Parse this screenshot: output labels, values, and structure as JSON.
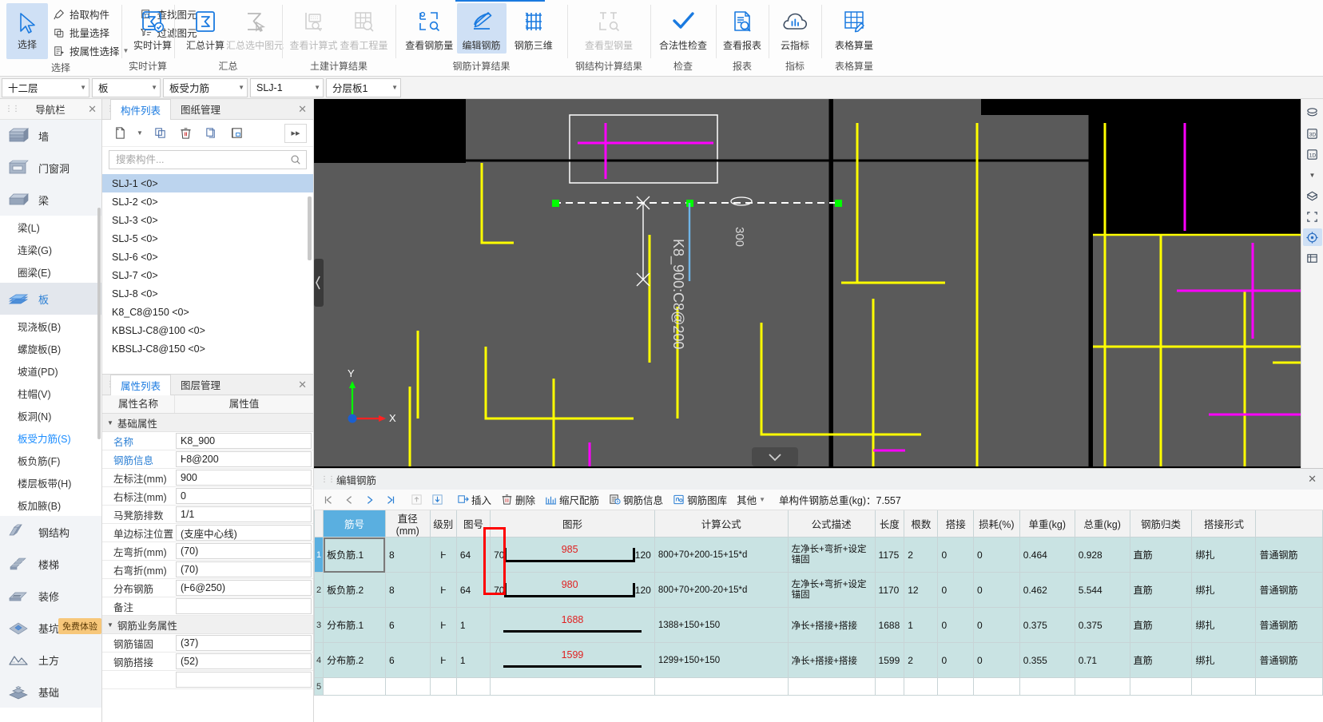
{
  "ribbon": {
    "groups": [
      {
        "label": "选择",
        "select_button": "选择",
        "small_items": [
          {
            "label": "拾取构件",
            "icon": "pick-component-icon",
            "caret": false
          },
          {
            "label": "批量选择",
            "icon": "batch-select-icon",
            "caret": false
          },
          {
            "label": "按属性选择",
            "icon": "select-by-property-icon",
            "caret": true
          }
        ],
        "small_items2": [
          {
            "label": "查找图元",
            "icon": "find-element-icon",
            "caret": false
          },
          {
            "label": "过滤图元",
            "icon": "filter-element-icon",
            "caret": false
          }
        ]
      },
      {
        "label": "实时计算",
        "buttons": [
          {
            "label": "实时计算",
            "icon": "realtime-calc-icon",
            "disabled": false,
            "selected": false
          }
        ]
      },
      {
        "label": "汇总",
        "buttons": [
          {
            "label": "汇总计算",
            "icon": "summary-calc-icon",
            "disabled": false,
            "selected": false
          },
          {
            "label": "汇总选中图元",
            "icon": "summary-selected-icon",
            "disabled": true,
            "selected": false
          }
        ]
      },
      {
        "label": "土建计算结果",
        "buttons": [
          {
            "label": "查看计算式",
            "icon": "view-formula-icon",
            "disabled": true,
            "selected": false
          },
          {
            "label": "查看工程量",
            "icon": "view-quantity-icon",
            "disabled": true,
            "selected": false
          }
        ]
      },
      {
        "label": "钢筋计算结果",
        "buttons": [
          {
            "label": "查看钢筋量",
            "icon": "view-rebar-quantity-icon",
            "disabled": false,
            "selected": false
          },
          {
            "label": "编辑钢筋",
            "icon": "edit-rebar-icon",
            "disabled": false,
            "selected": true
          },
          {
            "label": "钢筋三维",
            "icon": "rebar-3d-icon",
            "disabled": false,
            "selected": false
          }
        ]
      },
      {
        "label": "钢结构计算结果",
        "buttons": [
          {
            "label": "查看型钢量",
            "icon": "view-steel-quantity-icon",
            "disabled": true,
            "selected": false
          }
        ]
      },
      {
        "label": "检查",
        "buttons": [
          {
            "label": "合法性检查",
            "icon": "check-mark-icon",
            "disabled": false,
            "selected": false
          }
        ]
      },
      {
        "label": "报表",
        "buttons": [
          {
            "label": "查看报表",
            "icon": "view-report-icon",
            "disabled": false,
            "selected": false
          }
        ]
      },
      {
        "label": "指标",
        "buttons": [
          {
            "label": "云指标",
            "icon": "cloud-indicator-icon",
            "disabled": false,
            "selected": false
          }
        ]
      },
      {
        "label": "表格算量",
        "buttons": [
          {
            "label": "表格算量",
            "icon": "table-quantity-icon",
            "disabled": false,
            "selected": false
          }
        ]
      }
    ]
  },
  "selector_bar": {
    "combos": [
      {
        "name": "floor-select",
        "value": "十二层"
      },
      {
        "name": "category-select",
        "value": "板"
      },
      {
        "name": "element-type-select",
        "value": "板受力筋"
      },
      {
        "name": "component-select",
        "value": "SLJ-1"
      },
      {
        "name": "layer-select",
        "value": "分层板1"
      }
    ]
  },
  "nav": {
    "title": "导航栏",
    "close": "✕",
    "items": [
      {
        "label": "墙",
        "type": "cat",
        "icon": "wall-icon",
        "active": false
      },
      {
        "label": "门窗洞",
        "type": "cat",
        "icon": "door-window-icon",
        "active": false
      },
      {
        "label": "梁",
        "type": "cat",
        "icon": "beam-icon",
        "active": false
      },
      {
        "label": "梁(L)",
        "type": "sub",
        "active": false
      },
      {
        "label": "连梁(G)",
        "type": "sub",
        "active": false
      },
      {
        "label": "圈梁(E)",
        "type": "sub",
        "active": false
      },
      {
        "label": "板",
        "type": "cat",
        "icon": "slab-icon",
        "active": true
      },
      {
        "label": "现浇板(B)",
        "type": "sub",
        "active": false
      },
      {
        "label": "螺旋板(B)",
        "type": "sub",
        "active": false
      },
      {
        "label": "坡道(PD)",
        "type": "sub",
        "active": false
      },
      {
        "label": "柱帽(V)",
        "type": "sub",
        "active": false
      },
      {
        "label": "板洞(N)",
        "type": "sub",
        "active": false
      },
      {
        "label": "板受力筋(S)",
        "type": "sub",
        "active": true
      },
      {
        "label": "板负筋(F)",
        "type": "sub",
        "active": false
      },
      {
        "label": "楼层板带(H)",
        "type": "sub",
        "active": false
      },
      {
        "label": "板加腋(B)",
        "type": "sub",
        "active": false
      },
      {
        "label": "钢结构",
        "type": "cat",
        "icon": "steel-structure-icon",
        "active": false
      },
      {
        "label": "楼梯",
        "type": "cat",
        "icon": "stairs-icon",
        "active": false
      },
      {
        "label": "装修",
        "type": "cat",
        "icon": "decoration-icon",
        "active": false
      },
      {
        "label": "基坑工程",
        "type": "cat",
        "icon": "foundation-pit-icon",
        "active": false
      },
      {
        "label": "土方",
        "type": "cat",
        "icon": "earthwork-icon",
        "active": false
      },
      {
        "label": "基础",
        "type": "cat",
        "icon": "foundation-icon",
        "active": false
      }
    ],
    "free_trial_badge": "免费体验"
  },
  "component_panel": {
    "tabs": [
      {
        "label": "构件列表",
        "selected": true
      },
      {
        "label": "图纸管理",
        "selected": false
      }
    ],
    "close": "✕",
    "tools": [
      {
        "name": "new-component-button",
        "icon": "new-doc-icon"
      },
      {
        "name": "new-component-dropdown",
        "icon": "chevron-down-icon"
      },
      {
        "name": "copy-component-button",
        "icon": "copy-icon"
      },
      {
        "name": "delete-component-button",
        "icon": "trash-icon"
      },
      {
        "name": "duplicate-component-button",
        "icon": "layers-icon"
      },
      {
        "name": "save-component-button",
        "icon": "save-icon"
      },
      {
        "name": "expand-button",
        "icon": "double-chevron-right-icon"
      }
    ],
    "search_placeholder": "搜索构件...",
    "items": [
      {
        "label": "SLJ-1 <0>",
        "selected": true
      },
      {
        "label": "SLJ-2 <0>",
        "selected": false
      },
      {
        "label": "SLJ-3 <0>",
        "selected": false
      },
      {
        "label": "SLJ-5 <0>",
        "selected": false
      },
      {
        "label": "SLJ-6 <0>",
        "selected": false
      },
      {
        "label": "SLJ-7 <0>",
        "selected": false
      },
      {
        "label": "SLJ-8 <0>",
        "selected": false
      },
      {
        "label": "K8_C8@150 <0>",
        "selected": false
      },
      {
        "label": "KBSLJ-C8@100 <0>",
        "selected": false
      },
      {
        "label": "KBSLJ-C8@150 <0>",
        "selected": false
      }
    ]
  },
  "property_panel": {
    "tabs": [
      {
        "label": "属性列表",
        "selected": true
      },
      {
        "label": "图层管理",
        "selected": false
      }
    ],
    "close": "✕",
    "header": {
      "name_col": "属性名称",
      "value_col": "属性值"
    },
    "groups": [
      {
        "title": "基础属性",
        "rows": [
          {
            "name": "名称",
            "value": "K8_900",
            "blue": true
          },
          {
            "name": "钢筋信息",
            "value": "Ⱶ8@200",
            "blue": true
          },
          {
            "name": "左标注(mm)",
            "value": "900",
            "blue": false
          },
          {
            "name": "右标注(mm)",
            "value": "0",
            "blue": false
          },
          {
            "name": "马凳筋排数",
            "value": "1/1",
            "blue": false
          },
          {
            "name": "单边标注位置",
            "value": "(支座中心线)",
            "blue": false
          },
          {
            "name": "左弯折(mm)",
            "value": "(70)",
            "blue": false
          },
          {
            "name": "右弯折(mm)",
            "value": "(70)",
            "blue": false
          },
          {
            "name": "分布钢筋",
            "value": "(Ⱶ6@250)",
            "blue": false
          },
          {
            "name": "备注",
            "value": "",
            "blue": false
          }
        ]
      },
      {
        "title": "钢筋业务属性",
        "rows": [
          {
            "name": "钢筋锚固",
            "value": "(37)",
            "blue": false
          },
          {
            "name": "钢筋搭接",
            "value": "(52)",
            "blue": false
          }
        ]
      }
    ]
  },
  "canvas": {
    "annotations": [
      {
        "text": "K8_900:C8@200",
        "name": "rebar-label-k8-900"
      },
      {
        "text": "300",
        "name": "dimension-300"
      }
    ],
    "axis_x": "X",
    "axis_y": "Y"
  },
  "right_toolbar": {
    "buttons": [
      {
        "name": "view-layers-icon",
        "selected": false
      },
      {
        "name": "view-3d-icon",
        "selected": false
      },
      {
        "name": "view-dropdown-icon",
        "selected": false
      },
      {
        "name": "view-solid-icon",
        "selected": false
      },
      {
        "name": "view-fullscreen-icon",
        "selected": false
      },
      {
        "name": "view-target-icon",
        "selected": true
      },
      {
        "name": "view-table-icon",
        "selected": false
      }
    ],
    "labels": [
      "3D",
      "1D"
    ]
  },
  "bottom_panel": {
    "title": "编辑钢筋",
    "close": "✕",
    "nav_buttons": [
      {
        "name": "first-record-button",
        "icon": "first-icon"
      },
      {
        "name": "prev-record-button",
        "icon": "prev-icon"
      },
      {
        "name": "next-record-button",
        "icon": "next-icon"
      },
      {
        "name": "last-record-button",
        "icon": "last-icon"
      },
      {
        "name": "move-up-button",
        "icon": "up-arrow-icon"
      },
      {
        "name": "move-down-button",
        "icon": "down-arrow-icon"
      }
    ],
    "tools": [
      {
        "label": "插入",
        "icon": "insert-icon"
      },
      {
        "label": "删除",
        "icon": "delete-icon"
      },
      {
        "label": "缩尺配筋",
        "icon": "scale-rebar-icon"
      },
      {
        "label": "钢筋信息",
        "icon": "rebar-info-icon"
      },
      {
        "label": "钢筋图库",
        "icon": "rebar-library-icon"
      },
      {
        "label": "其他",
        "icon": "other-icon",
        "caret": true
      }
    ],
    "total_label": "单构件钢筋总重(kg)：7.557",
    "table": {
      "columns": [
        "筋号",
        "直径(mm)",
        "级别",
        "图号",
        "图形",
        "计算公式",
        "公式描述",
        "长度",
        "根数",
        "搭接",
        "损耗(%)",
        "单重(kg)",
        "总重(kg)",
        "钢筋归类",
        "搭接形式"
      ],
      "rows": [
        {
          "idx": "1",
          "筋号": "板负筋.1",
          "直径(mm)": "8",
          "级别": "Ⱶ",
          "图号": "64",
          "shape": {
            "left": "70",
            "mid": "985",
            "right": "120",
            "type": "hooked-both"
          },
          "计算公式": "800+70+200-15+15*d",
          "公式描述": "左净长+弯折+设定锚固",
          "长度": "1175",
          "根数": "2",
          "搭接": "0",
          "损耗(%)": "0",
          "单重(kg)": "0.464",
          "总重(kg)": "0.928",
          "钢筋归类": "直筋",
          "搭接形式": "绑扎",
          "普通钢筋": "普通钢筋",
          "selected": true
        },
        {
          "idx": "2",
          "筋号": "板负筋.2",
          "直径(mm)": "8",
          "级别": "Ⱶ",
          "图号": "64",
          "shape": {
            "left": "70",
            "mid": "980",
            "right": "120",
            "type": "hooked-both"
          },
          "计算公式": "800+70+200-20+15*d",
          "公式描述": "左净长+弯折+设定锚固",
          "长度": "1170",
          "根数": "12",
          "搭接": "0",
          "损耗(%)": "0",
          "单重(kg)": "0.462",
          "总重(kg)": "5.544",
          "钢筋归类": "直筋",
          "搭接形式": "绑扎",
          "普通钢筋": "普通钢筋",
          "selected": false
        },
        {
          "idx": "3",
          "筋号": "分布筋.1",
          "直径(mm)": "6",
          "级别": "Ⱶ",
          "图号": "1",
          "shape": {
            "left": "",
            "mid": "1688",
            "right": "",
            "type": "straight"
          },
          "计算公式": "1388+150+150",
          "公式描述": "净长+搭接+搭接",
          "长度": "1688",
          "根数": "1",
          "搭接": "0",
          "损耗(%)": "0",
          "单重(kg)": "0.375",
          "总重(kg)": "0.375",
          "钢筋归类": "直筋",
          "搭接形式": "绑扎",
          "普通钢筋": "普通钢筋",
          "selected": false
        },
        {
          "idx": "4",
          "筋号": "分布筋.2",
          "直径(mm)": "6",
          "级别": "Ⱶ",
          "图号": "1",
          "shape": {
            "left": "",
            "mid": "1599",
            "right": "",
            "type": "straight"
          },
          "计算公式": "1299+150+150",
          "公式描述": "净长+搭接+搭接",
          "长度": "1599",
          "根数": "2",
          "搭接": "0",
          "损耗(%)": "0",
          "单重(kg)": "0.355",
          "总重(kg)": "0.71",
          "钢筋归类": "直筋",
          "搭接形式": "绑扎",
          "普通钢筋": "普通钢筋",
          "selected": false
        },
        {
          "idx": "5",
          "筋号": "",
          "直径(mm)": "",
          "级别": "",
          "图号": "",
          "shape": {
            "left": "",
            "mid": "",
            "right": "",
            "type": "none"
          },
          "计算公式": "",
          "公式描述": "",
          "长度": "",
          "根数": "",
          "搭接": "",
          "损耗(%)": "",
          "单重(kg)": "",
          "总重(kg)": "",
          "钢筋归类": "",
          "搭接形式": "",
          "普通钢筋": "",
          "selected": false
        }
      ]
    }
  },
  "colors": {
    "accent": "#1a7ae0",
    "selected_row": "#c9e3e3",
    "header_key": "#5aafe0",
    "red_highlight": "#ff0000",
    "shape_number": "#e02020",
    "canvas_bg": "#000000",
    "slab_gray": "#5a5a5a",
    "rebar_yellow": "#ffff00",
    "rebar_magenta": "#ff00ff"
  }
}
